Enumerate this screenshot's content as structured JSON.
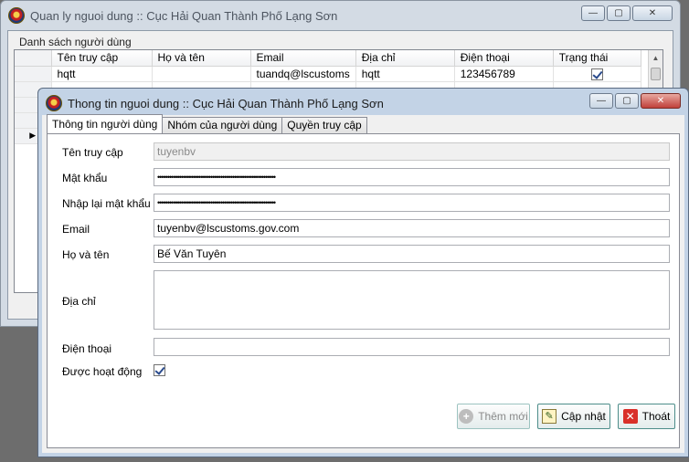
{
  "back_window": {
    "title": "Quan ly nguoi dung :: Cục Hải Quan Thành Phố Lạng Sơn",
    "group_label": "Danh sách người dùng",
    "columns": [
      "Tên truy cập",
      "Họ và tên",
      "Email",
      "Địa chỉ",
      "Điện thoại",
      "Trạng thái"
    ],
    "rows": [
      [
        "hqtt",
        "",
        "tuandq@lscustoms",
        "hqtt",
        "123456789",
        ""
      ]
    ],
    "row_status_checked": [
      true
    ],
    "caption_buttons": {
      "minimize": "—",
      "maximize": "▢",
      "close": "✕"
    }
  },
  "front_window": {
    "title": "Thong tin nguoi dung :: Cục Hải Quan Thành Phố Lạng Sơn",
    "caption_buttons": {
      "minimize": "—",
      "maximize": "▢",
      "close": "✕"
    },
    "tabs": [
      "Thông tin người dùng",
      "Nhóm của người dùng",
      "Quyền truy cập"
    ],
    "active_tab": 0,
    "form": {
      "username_label": "Tên truy cập",
      "username_value": "tuyenbv",
      "password_label": "Mật khẩu",
      "password_value": "••••••••••••••••••••••••••••••••••••••••••••••••••••••••••••",
      "confirm_label": "Nhập lại mật khẩu",
      "confirm_value": "••••••••••••••••••••••••••••••••••••••••••••••••••••••••••••",
      "email_label": "Email",
      "email_value": "tuyenbv@lscustoms.gov.com",
      "fullname_label": "Họ và tên",
      "fullname_value": "Bế Văn Tuyên",
      "address_label": "Địa chỉ",
      "address_value": "",
      "phone_label": "Điện thoại",
      "phone_value": "",
      "active_label": "Được hoạt động",
      "active_checked": true
    },
    "buttons": {
      "add": "Thêm mới",
      "update": "Cập nhật",
      "exit": "Thoát"
    }
  }
}
